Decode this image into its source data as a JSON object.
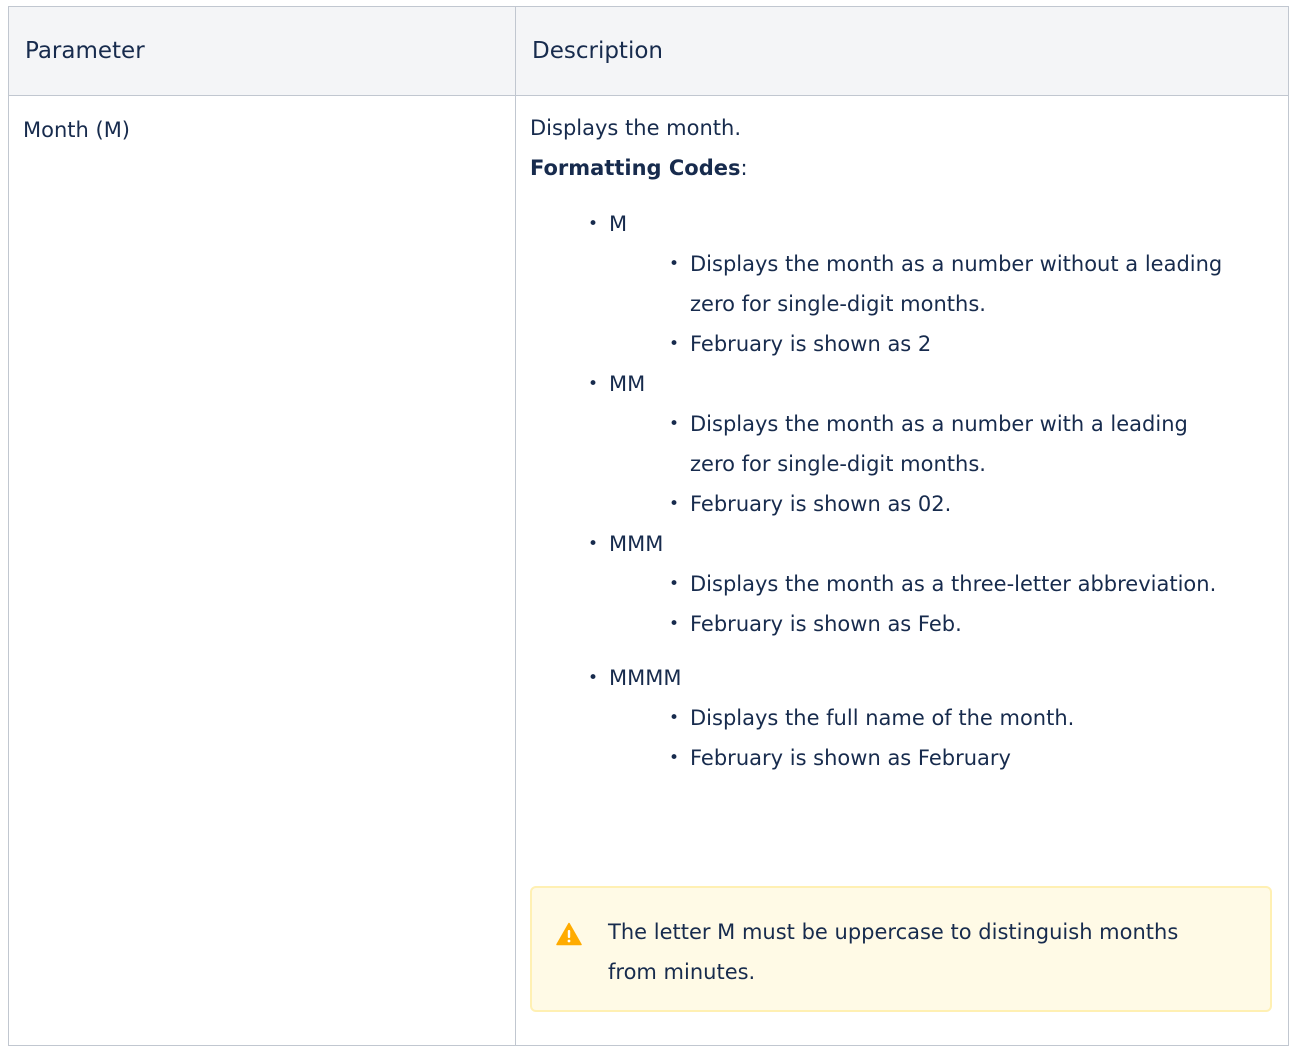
{
  "table": {
    "headers": {
      "parameter": "Parameter",
      "description": "Description"
    },
    "row": {
      "parameter": "Month (M)",
      "intro": "Displays the month.",
      "formatting_label": "Formatting Codes",
      "formatting_colon": ":",
      "codes": [
        {
          "code": "M",
          "details": [
            "Displays the month as a number without a leading zero for single-digit months.",
            "February is shown as 2"
          ]
        },
        {
          "code": "MM",
          "details": [
            "Displays the month as a number with a leading zero for single-digit months.",
            "February is shown as 02."
          ]
        },
        {
          "code": "MMM",
          "details": [
            "Displays the month as a three-letter abbreviation.",
            "February is shown as Feb."
          ]
        },
        {
          "code": "MMMM",
          "details": [
            "Displays the full name of the month.",
            "February is shown as February"
          ]
        }
      ]
    }
  },
  "warning": {
    "icon": "warning-triangle-icon",
    "text": "The letter M must be uppercase to distinguish months from minutes.",
    "icon_color": "#ffab00",
    "background_color": "#fffae6",
    "border_color": "#fff0b3"
  },
  "bullet_glyph": "•"
}
